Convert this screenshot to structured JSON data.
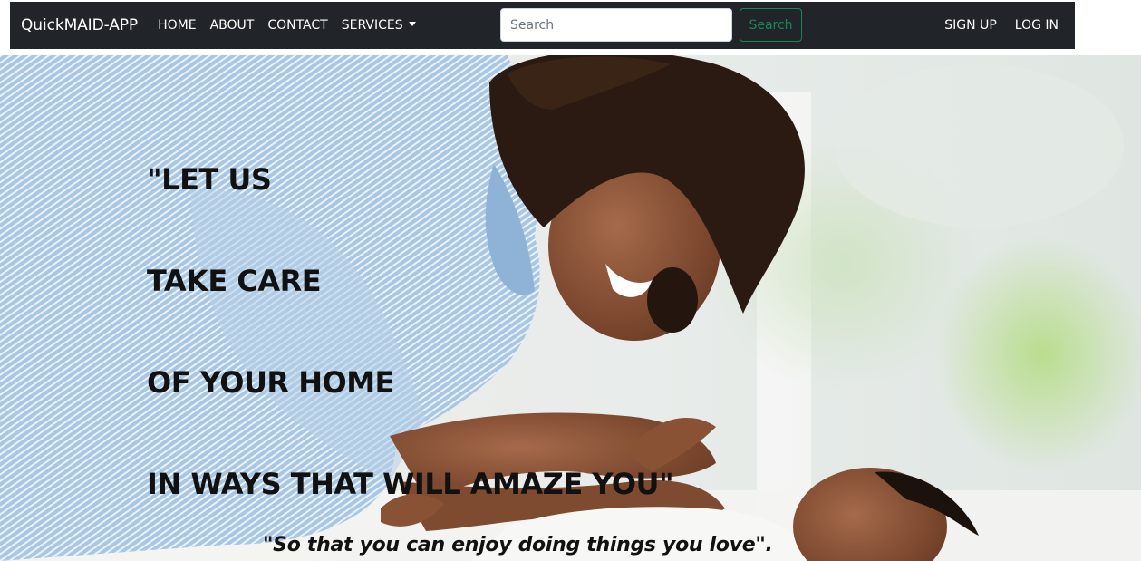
{
  "navbar": {
    "brand": "QuickMAID-APP",
    "links": [
      {
        "label": "HOME"
      },
      {
        "label": "ABOUT"
      },
      {
        "label": "CONTACT"
      },
      {
        "label": "SERVICES"
      }
    ],
    "search": {
      "placeholder": "Search",
      "value": "",
      "button_label": "Search"
    },
    "auth": {
      "signup_label": "SIGN UP",
      "login_label": "LOG IN"
    }
  },
  "hero": {
    "heading_lines": [
      "\"LET US",
      "TAKE CARE",
      "OF YOUR HOME",
      "IN WAYS THAT WILL AMAZE YOU\""
    ],
    "tagline": "\"So that you can enjoy doing things you love\"."
  },
  "colors": {
    "navbar_bg": "#212529",
    "search_btn_accent": "#198754",
    "hero_text": "#111111"
  },
  "icons": {
    "services_dropdown": "caret-down-icon"
  }
}
